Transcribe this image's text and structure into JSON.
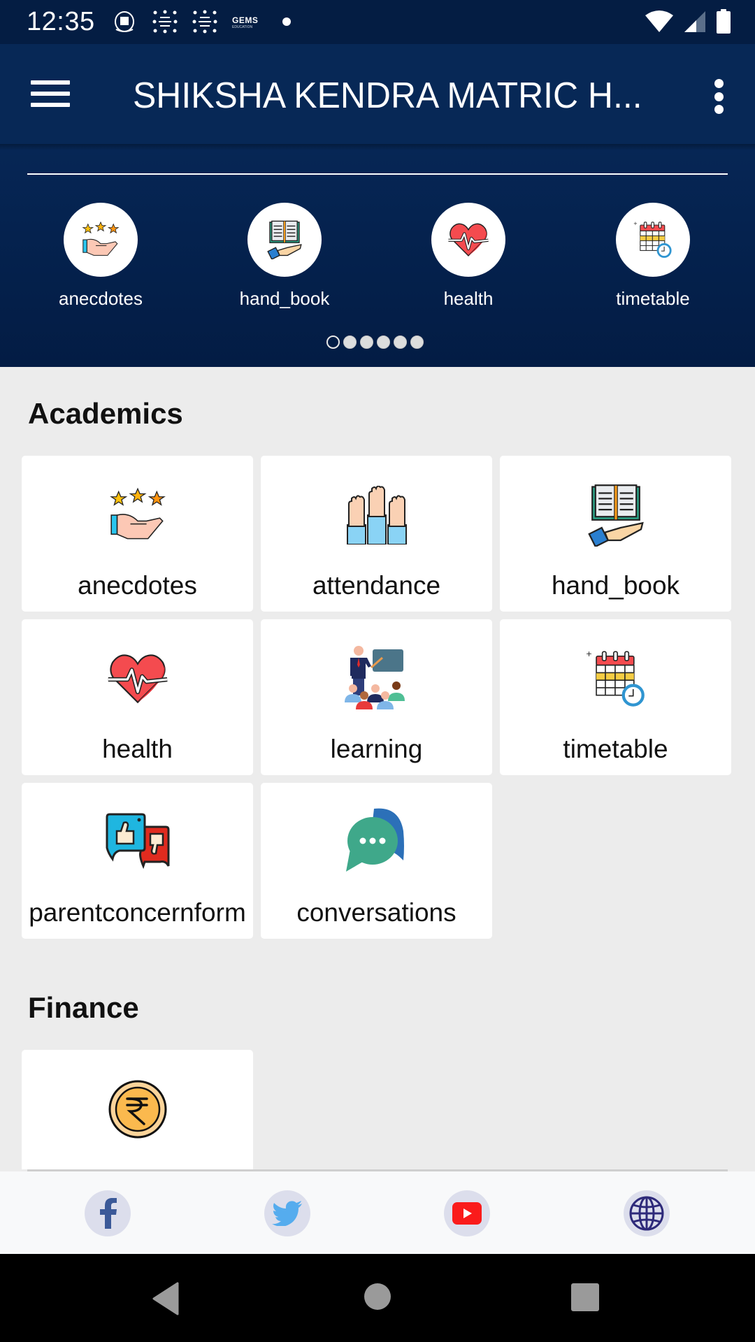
{
  "status_bar": {
    "time": "12:35",
    "notification_icons": [
      "school-crest-icon",
      "anniversary-badge-icon",
      "anniversary-badge-icon",
      "gems-education-icon",
      "notification-dot-icon"
    ],
    "gems_text": "GEMS",
    "gems_subtext": "EDUCATION",
    "system_icons": [
      "wifi-icon",
      "cellular-signal-icon",
      "battery-icon"
    ]
  },
  "app_bar": {
    "title": "SHIKSHA KENDRA MATRIC H...",
    "menu_icon": "hamburger-menu-icon",
    "overflow_icon": "more-vert-icon"
  },
  "quick_access": {
    "items": [
      {
        "label": "anecdotes",
        "icon": "stars-hand-icon"
      },
      {
        "label": "hand_book",
        "icon": "book-hand-icon"
      },
      {
        "label": "health",
        "icon": "heartbeat-icon"
      },
      {
        "label": "timetable",
        "icon": "calendar-clock-icon"
      }
    ],
    "pager": {
      "total_pages": 6,
      "active_page": 1
    }
  },
  "sections": [
    {
      "title": "Academics",
      "tiles": [
        {
          "label": "anecdotes",
          "icon": "stars-hand-icon"
        },
        {
          "label": "attendance",
          "icon": "raised-hands-icon"
        },
        {
          "label": "hand_book",
          "icon": "book-hand-icon"
        },
        {
          "label": "health",
          "icon": "heartbeat-icon"
        },
        {
          "label": "learning",
          "icon": "teacher-class-icon"
        },
        {
          "label": "timetable",
          "icon": "calendar-clock-icon"
        },
        {
          "label": "parentconcernform",
          "icon": "feedback-thumbs-icon"
        },
        {
          "label": "conversations",
          "icon": "chat-bubbles-icon"
        }
      ]
    },
    {
      "title": "Finance",
      "tiles": [
        {
          "label": "",
          "icon": "rupee-coin-icon"
        }
      ]
    }
  ],
  "social_links": [
    {
      "name": "facebook",
      "icon": "facebook-icon"
    },
    {
      "name": "twitter",
      "icon": "twitter-icon"
    },
    {
      "name": "youtube",
      "icon": "youtube-icon"
    },
    {
      "name": "website",
      "icon": "globe-icon"
    }
  ],
  "nav_bar": {
    "buttons": [
      "back",
      "home",
      "recents"
    ]
  },
  "colors": {
    "status_bar": "#041d43",
    "app_bar": "#072856",
    "hero_bg": "#062655",
    "page_bg": "#ececec",
    "tile_bg": "#ffffff",
    "social_btn_bg": "#dcdeec",
    "facebook": "#3b5998",
    "twitter": "#55acee",
    "youtube": "#ff0000",
    "globe": "#2e2a7a"
  }
}
